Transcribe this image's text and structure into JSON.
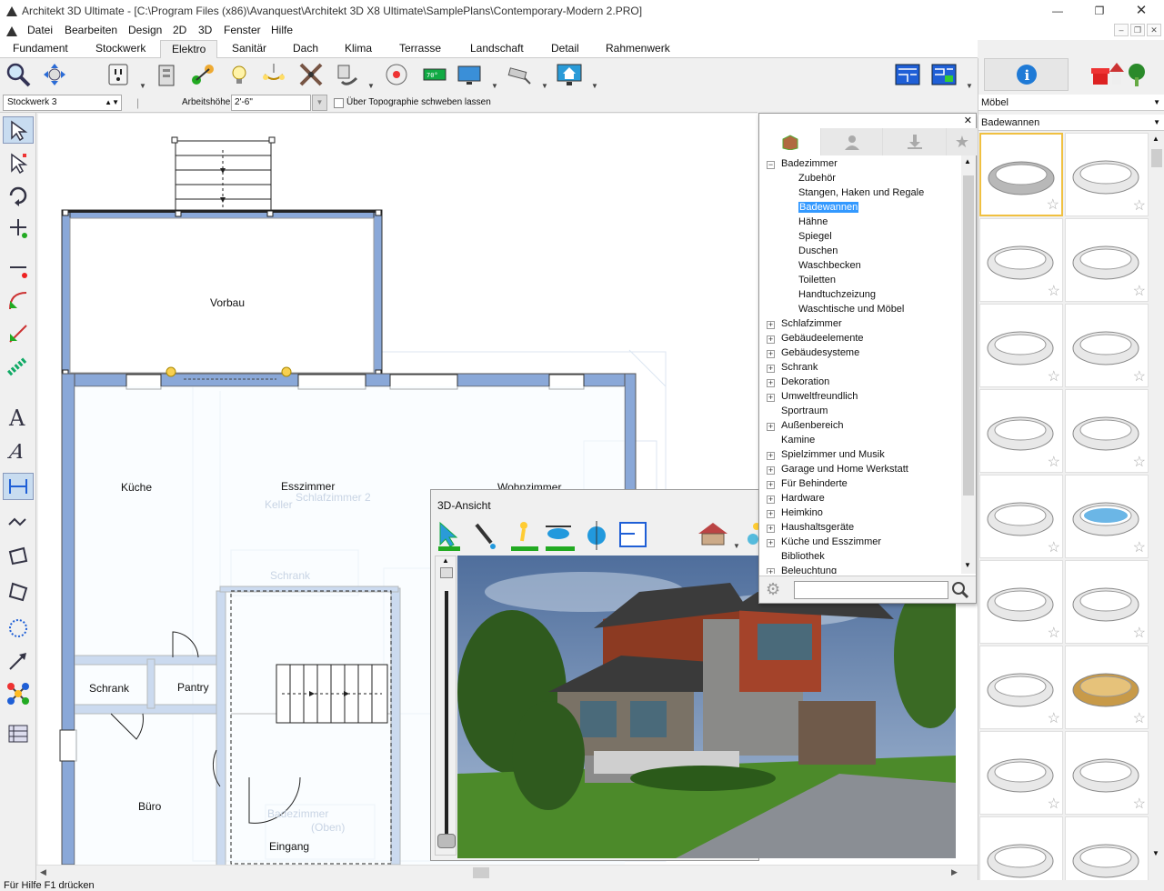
{
  "window": {
    "title": "Architekt 3D Ultimate - [C:\\Program Files (x86)\\Avanquest\\Architekt 3D X8 Ultimate\\SamplePlans\\Contemporary-Modern 2.PRO]"
  },
  "menu": [
    "Datei",
    "Bearbeiten",
    "Design",
    "2D",
    "3D",
    "Fenster",
    "Hilfe"
  ],
  "tabs": [
    "Fundament",
    "Stockwerk",
    "Elektro",
    "Sanitär",
    "Dach",
    "Klima",
    "Terrasse",
    "Landschaft",
    "Detail",
    "Rahmenwerk"
  ],
  "active_tab": "Elektro",
  "options": {
    "floor_select": "Stockwerk 3",
    "height_label": "Arbeitshöhe:",
    "height_value": "2'-6\"",
    "topo_label": "Über Topographie schweben lassen"
  },
  "plan": {
    "rooms": [
      "Vorbau",
      "Küche",
      "Esszimmer",
      "Wohnzimmer",
      "Schrank",
      "Pantry",
      "Büro",
      "Eingang"
    ],
    "ghost": [
      "Schlafzimmer 2",
      "Keller",
      "Schrank",
      "Badezimmer",
      "(Oben)"
    ]
  },
  "view3d": {
    "title": "3D-Ansicht"
  },
  "catalog": {
    "tree_root": "Badezimmer",
    "children": [
      "Zubehör",
      "Stangen, Haken und Regale",
      "Badewannen",
      "Hähne",
      "Spiegel",
      "Duschen",
      "Waschbecken",
      "Toiletten",
      "Handtuchzeizung",
      "Waschtische und Möbel"
    ],
    "selected": "Badewannen",
    "groups": [
      "Schlafzimmer",
      "Gebäudeelemente",
      "Gebäudesysteme",
      "Schrank",
      "Dekoration",
      "Umweltfreundlich",
      "Sportraum",
      "Außenbereich",
      "Kamine",
      "Spielzimmer und Musik",
      "Garage und Home Werkstatt",
      "Für Behinderte",
      "Hardware",
      "Heimkino",
      "Haushaltsgeräte",
      "Küche und Esszimmer",
      "Bibliothek",
      "Beleuchtung"
    ],
    "expandable": [
      true,
      true,
      true,
      true,
      true,
      true,
      false,
      true,
      false,
      true,
      true,
      true,
      true,
      true,
      true,
      true,
      false,
      true
    ],
    "search_value": ""
  },
  "right_panel": {
    "category": "Möbel",
    "subcategory": "Badewannen",
    "thumb_count": 18
  },
  "status": "Für Hilfe F1 drücken"
}
